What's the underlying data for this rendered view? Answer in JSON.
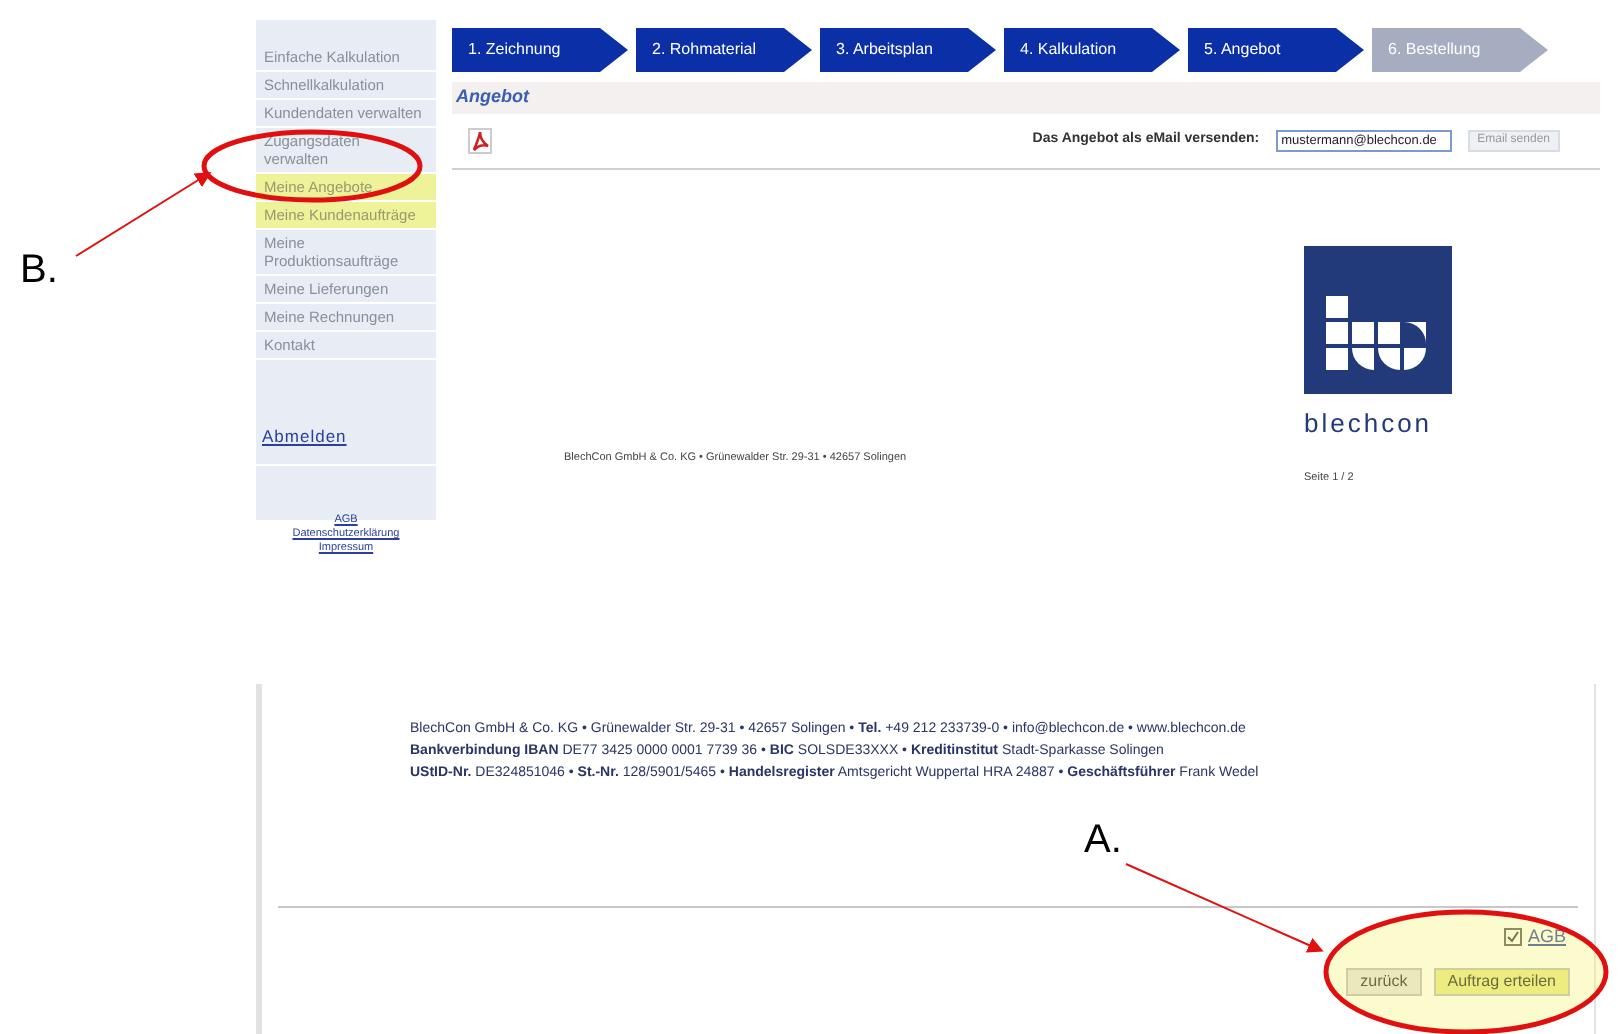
{
  "sidebar": {
    "items": [
      {
        "label": "Einfache Kalkulation",
        "highlighted": false
      },
      {
        "label": "Schnellkalkulation",
        "highlighted": false
      },
      {
        "label": "Kundendaten verwalten",
        "highlighted": false
      },
      {
        "label": "Zugangsdaten verwalten",
        "highlighted": false
      },
      {
        "label": "Meine Angebote",
        "highlighted": true
      },
      {
        "label": "Meine Kundenaufträge",
        "highlighted": true
      },
      {
        "label": "Meine Produktionsaufträge",
        "highlighted": false
      },
      {
        "label": "Meine Lieferungen",
        "highlighted": false
      },
      {
        "label": "Meine Rechnungen",
        "highlighted": false
      },
      {
        "label": "Kontakt",
        "highlighted": false
      }
    ],
    "logout": "Abmelden",
    "footer_links": [
      "AGB",
      "Datenschutzerklärung",
      "Impressum"
    ]
  },
  "steps": [
    {
      "label": "1. Zeichnung",
      "done": true
    },
    {
      "label": "2. Rohmaterial",
      "done": true
    },
    {
      "label": "3. Arbeitsplan",
      "done": true
    },
    {
      "label": "4. Kalkulation",
      "done": true
    },
    {
      "label": "5. Angebot",
      "done": true
    },
    {
      "label": "6. Bestellung",
      "done": false
    }
  ],
  "section_title": "Angebot",
  "email": {
    "label": "Das Angebot als eMail versenden:",
    "value": "mustermann@blechcon.de",
    "button": "Email senden"
  },
  "document": {
    "footer": "BlechCon GmbH & Co. KG • Grünewalder Str. 29-31 • 42657 Solingen",
    "logo_text": "blechcon",
    "page": "Seite 1 / 2"
  },
  "document_footer": [
    "BlechCon GmbH & Co. KG • Grünewalder Str. 29-31 • 42657 Solingen • **Tel.** +49 212 233739-0 • info@blechcon.de • www.blechcon.de",
    "**Bankverbindung IBAN** DE77 3425 0000 0001 7739 36 • **BIC** SOLSDE33XXX • **Kreditinstitut** Stadt-Sparkasse Solingen",
    "**UStID-Nr.** DE324851046 • **St.-Nr.** 128/5901/5465 • **Handelsregister** Amtsgericht Wuppertal HRA 24887 • **Geschäftsführer** Frank Wedel"
  ],
  "agb": {
    "label": "AGB",
    "checked": true
  },
  "buttons": [
    {
      "label": "zurück",
      "highlighted": false
    },
    {
      "label": "Auftrag erteilen",
      "highlighted": true
    }
  ],
  "annotations": [
    "B.",
    "A."
  ]
}
